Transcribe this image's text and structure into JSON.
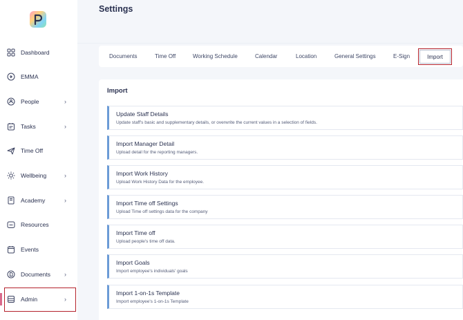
{
  "page": {
    "title": "Settings"
  },
  "sidebar": {
    "items": [
      {
        "label": "Dashboard",
        "icon": "dashboard-icon",
        "chevron": false
      },
      {
        "label": "EMMA",
        "icon": "emma-icon",
        "chevron": false
      },
      {
        "label": "People",
        "icon": "people-icon",
        "chevron": true
      },
      {
        "label": "Tasks",
        "icon": "tasks-icon",
        "chevron": true
      },
      {
        "label": "Time Off",
        "icon": "plane-icon",
        "chevron": false
      },
      {
        "label": "Wellbeing",
        "icon": "sun-icon",
        "chevron": true
      },
      {
        "label": "Academy",
        "icon": "book-icon",
        "chevron": true
      },
      {
        "label": "Resources",
        "icon": "folder-icon",
        "chevron": false
      },
      {
        "label": "Events",
        "icon": "calendar-icon",
        "chevron": false
      },
      {
        "label": "Documents",
        "icon": "document-icon",
        "chevron": true
      },
      {
        "label": "Admin",
        "icon": "admin-icon",
        "chevron": true
      }
    ],
    "chevron_glyph": "›"
  },
  "tabs": {
    "items": [
      {
        "label": "Documents"
      },
      {
        "label": "Time Off"
      },
      {
        "label": "Working Schedule"
      },
      {
        "label": "Calendar"
      },
      {
        "label": "Location"
      },
      {
        "label": "General Settings"
      },
      {
        "label": "E-Sign"
      },
      {
        "label": "Import"
      }
    ],
    "active": "Import"
  },
  "import": {
    "heading": "Import",
    "cards": [
      {
        "title": "Update Staff Details",
        "desc": "Update staff's basic and supplementary details, or overwrite the current values in a selection of fields."
      },
      {
        "title": "Import Manager Detail",
        "desc": "Upload detail for the reporting managers."
      },
      {
        "title": "Import Work History",
        "desc": "Upload Work History Data for the employee."
      },
      {
        "title": "Import Time off Settings",
        "desc": "Upload Time off settings data for the company"
      },
      {
        "title": "Import Time off",
        "desc": "Upload people's time off data."
      },
      {
        "title": "Import Goals",
        "desc": "Import employee's individuals' goals"
      },
      {
        "title": "Import 1-on-1s Template",
        "desc": "Import employee's 1-on-1s Template"
      }
    ]
  },
  "colors": {
    "accent": "#6b9bd6",
    "highlight_border": "#b3202a",
    "text": "#2a3150"
  }
}
